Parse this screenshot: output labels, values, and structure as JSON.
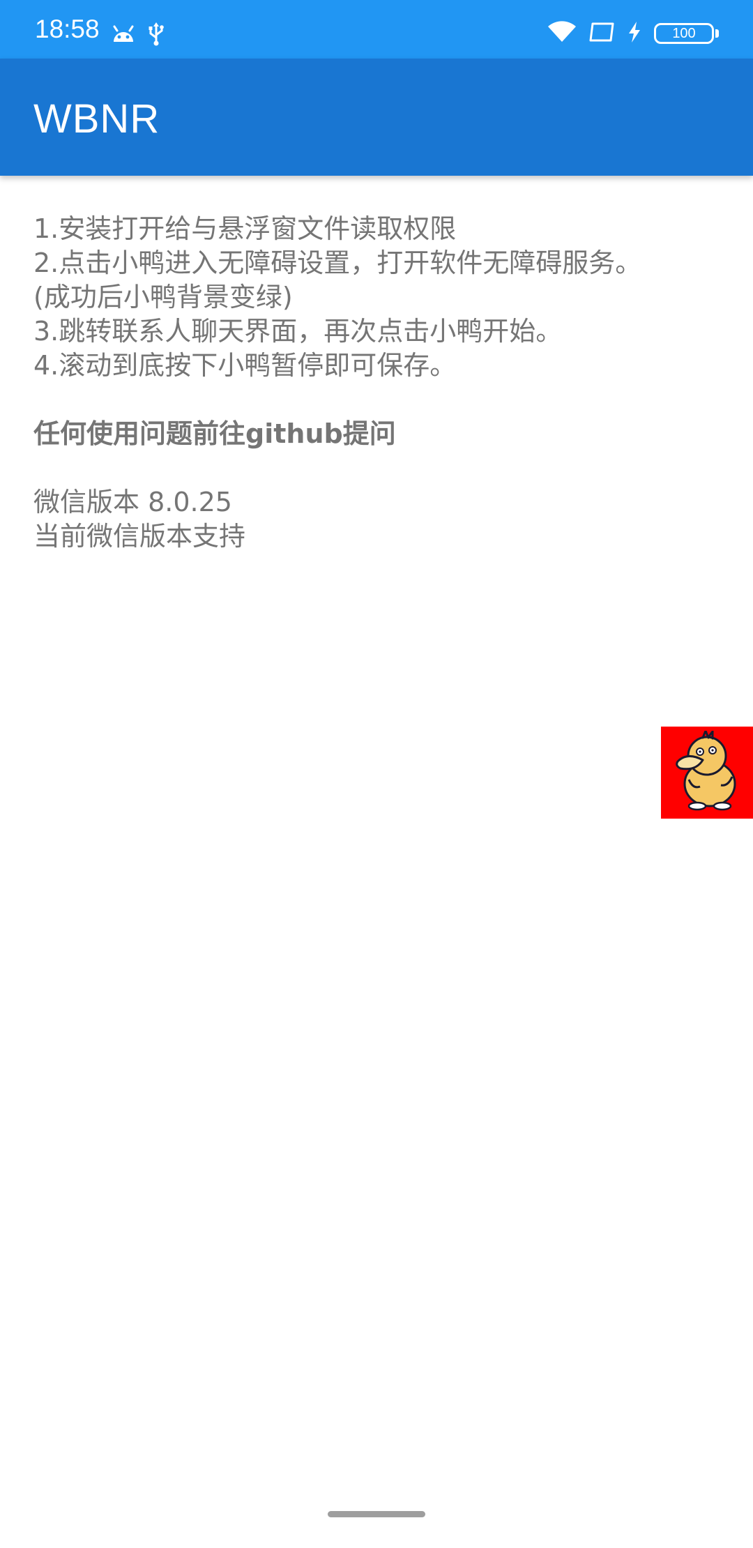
{
  "status_bar": {
    "time": "18:58",
    "battery_level": "100",
    "background_color": "#2196F3",
    "icons": [
      "android-icon",
      "usb-icon",
      "wifi-icon",
      "screen-cast-icon",
      "charging-icon",
      "battery-icon"
    ]
  },
  "app_bar": {
    "title": "WBNR",
    "background_color": "#1976D2"
  },
  "instructions": [
    "1.安装打开给与悬浮窗文件读取权限",
    "2.点击小鸭进入无障碍设置，打开软件无障碍服务。",
    "(成功后小鸭背景变绿)",
    "3.跳转联系人聊天界面，再次点击小鸭开始。",
    "4.滚动到底按下小鸭暂停即可保存。"
  ],
  "help_link": "任何使用问题前往github提问",
  "version": {
    "wechat_version": "微信版本 8.0.25",
    "support_status": "当前微信版本支持"
  },
  "floating_button": {
    "icon": "duck-icon",
    "background_color": "#ff0000"
  }
}
